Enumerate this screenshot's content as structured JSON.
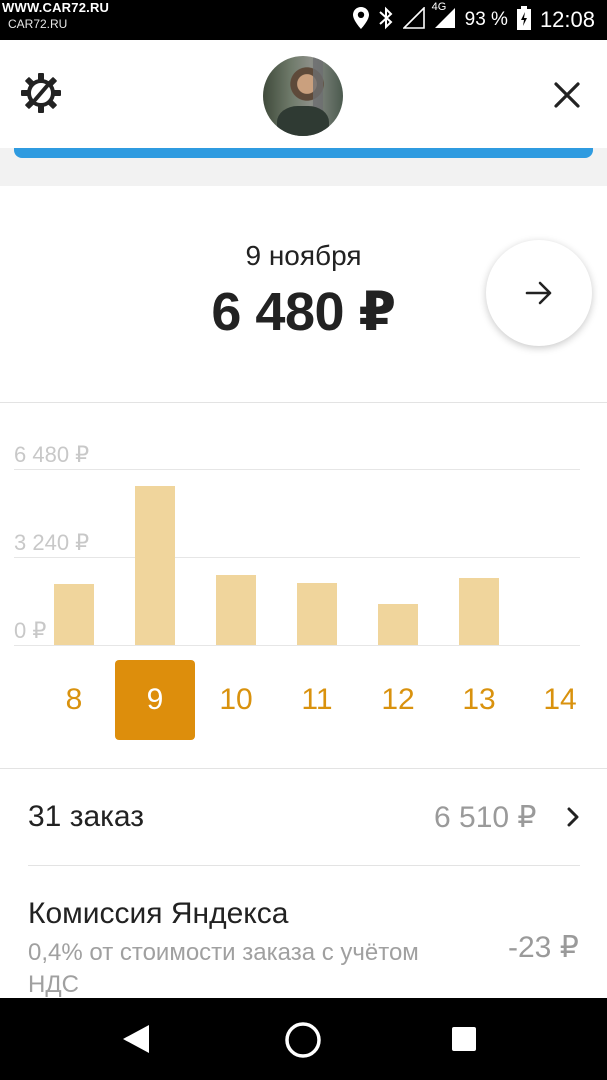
{
  "status_bar": {
    "watermark_top": "WWW.CAR72.RU",
    "watermark_bottom": "CAR72.RU",
    "network": "4G",
    "battery": "93 %",
    "time": "12:08"
  },
  "header": {
    "icons": [
      "gear-icon",
      "avatar",
      "close-icon"
    ]
  },
  "summary": {
    "date": "9 ноября",
    "amount": "6 480 ₽"
  },
  "chart_data": {
    "type": "bar",
    "categories": [
      "8",
      "9",
      "10",
      "11",
      "12",
      "13",
      "14"
    ],
    "values": [
      2250,
      5850,
      2560,
      2290,
      1510,
      2480,
      0
    ],
    "y_ticks": [
      "6 480 ₽",
      "3 240 ₽",
      "0 ₽"
    ],
    "ylim": [
      0,
      6480
    ],
    "selected": "9",
    "bar_color": "#f0d59c",
    "selected_color": "#dd8e0c",
    "label_color": "#d9920e",
    "grid": true
  },
  "orders": {
    "label": "31 заказ",
    "value": "6 510 ₽"
  },
  "commission": {
    "title": "Комиссия Яндекса",
    "subtitle_line1": "0,4% от стоимости заказа с учётом",
    "subtitle_line2": "НДС",
    "value": "-23 ₽"
  },
  "colors": {
    "accent_blue": "#2f9be0",
    "accent_orange": "#dd8e0c"
  }
}
